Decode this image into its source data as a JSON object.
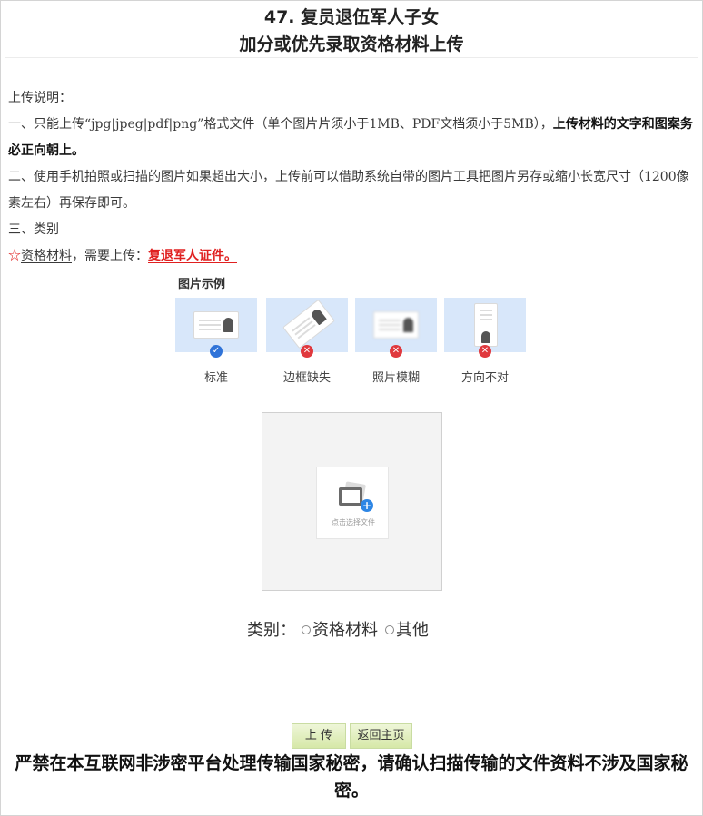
{
  "header": {
    "title_line1": "47. 复员退伍军人子女",
    "title_line2": "加分或优先录取资格材料上传"
  },
  "instructions": {
    "heading": "上传说明：",
    "rule1_text": "一、只能上传“jpg|jpeg|pdf|png”格式文件（单个图片片须小于1MB、PDF文档须小于5MB），",
    "rule1_bold": "上传材料的文字和图案务必正向朝上。",
    "rule2_text": "二、使用手机拍照或扫描的图片如果超出大小，上传前可以借助系统自带的图片工具把图片另存或缩小长宽尺寸（1200像素左右）再保存即可。",
    "rule3_text": "三、类别",
    "star": "☆",
    "category_name": "资格材料",
    "need_text": "，需要上传：",
    "required_doc": "复退军人证件。"
  },
  "examples": {
    "title": "图片示例",
    "items": [
      {
        "label": "标准",
        "status": "ok",
        "icon": "check-icon"
      },
      {
        "label": "边框缺失",
        "status": "bad",
        "icon": "x-icon"
      },
      {
        "label": "照片模糊",
        "status": "bad",
        "icon": "x-icon"
      },
      {
        "label": "方向不对",
        "status": "bad",
        "icon": "x-icon"
      }
    ],
    "ok_glyph": "✓",
    "bad_glyph": "✕",
    "card_color": "#d8e7fa"
  },
  "upload": {
    "hint": "点击选择文件",
    "plus_glyph": "+"
  },
  "category": {
    "label": "类别：",
    "options": [
      "资格材料",
      "其他"
    ]
  },
  "buttons": {
    "upload_label": "上  传",
    "home_label": "返回主页"
  },
  "warning": "严禁在本互联网非涉密平台处理传输国家秘密，请确认扫描传输的文件资料不涉及国家秘密。",
  "colors": {
    "accent_red": "#e02020",
    "button_green": "#d6e8a8",
    "ok_blue": "#2f73d8",
    "bad_red": "#e0393e"
  }
}
